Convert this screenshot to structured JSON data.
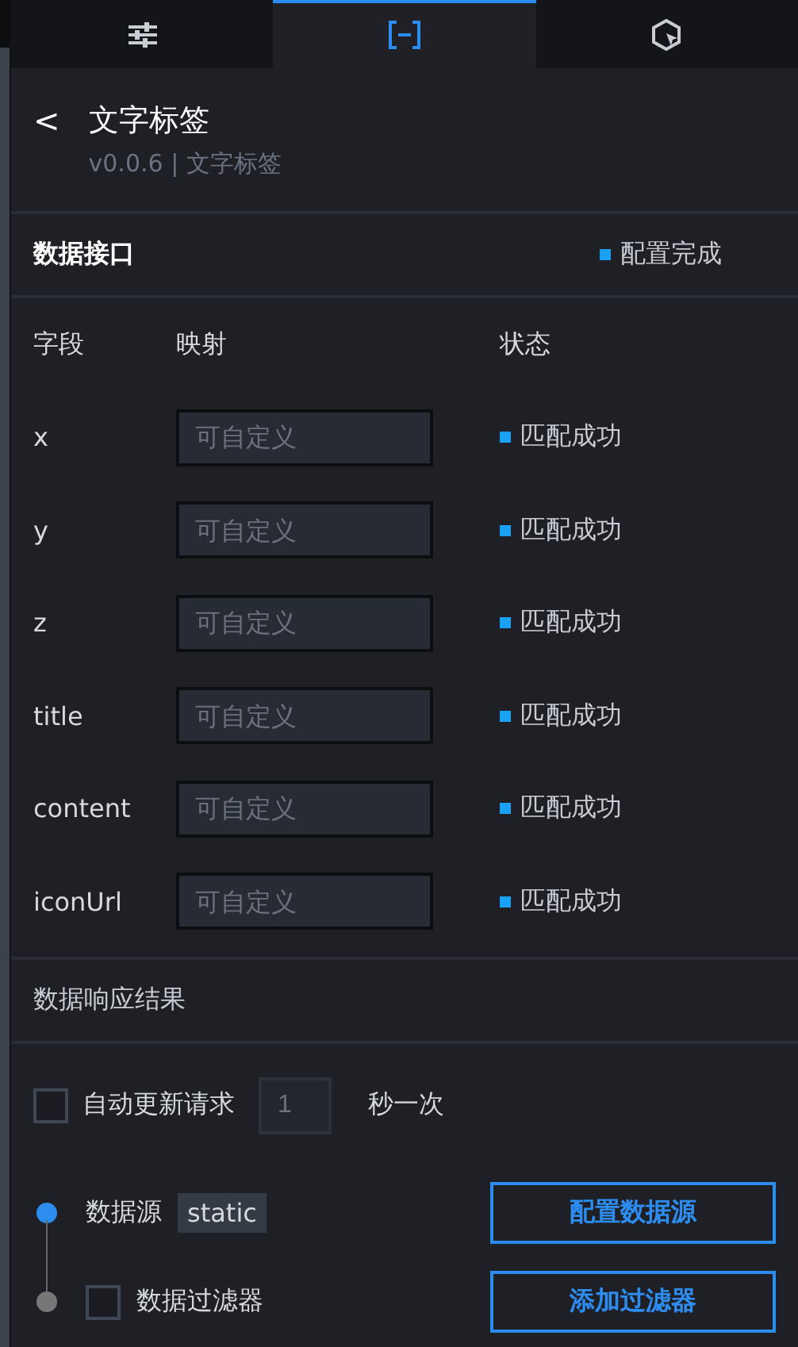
{
  "tabs": [
    {
      "kind": "sliders",
      "selected": false
    },
    {
      "kind": "bracket",
      "selected": true
    },
    {
      "kind": "cursor",
      "selected": false
    }
  ],
  "header": {
    "back": "<",
    "title": "文字标签",
    "subtitle": "v0.0.6 | 文字标签"
  },
  "interface": {
    "title": "数据接口",
    "status": "配置完成"
  },
  "columns": [
    "字段",
    "映射",
    "状态"
  ],
  "fields": [
    {
      "name": "x",
      "placeholder": "可自定义",
      "status": "匹配成功"
    },
    {
      "name": "y",
      "placeholder": "可自定义",
      "status": "匹配成功"
    },
    {
      "name": "z",
      "placeholder": "可自定义",
      "status": "匹配成功"
    },
    {
      "name": "title",
      "placeholder": "可自定义",
      "status": "匹配成功"
    },
    {
      "name": "content",
      "placeholder": "可自定义",
      "status": "匹配成功"
    },
    {
      "name": "iconUrl",
      "placeholder": "可自定义",
      "status": "匹配成功"
    }
  ],
  "response": {
    "title": "数据响应结果"
  },
  "auto_update": {
    "checked": false,
    "label": "自动更新请求",
    "placeholder": "1",
    "unit": "秒一次"
  },
  "steps": [
    {
      "label": "数据源",
      "tag": "static",
      "button": "配置数据源",
      "active": true,
      "kind": "tag"
    },
    {
      "label": "数据过滤器",
      "button": "添加过滤器",
      "active": false,
      "kind": "checkbox",
      "checked": false
    }
  ]
}
